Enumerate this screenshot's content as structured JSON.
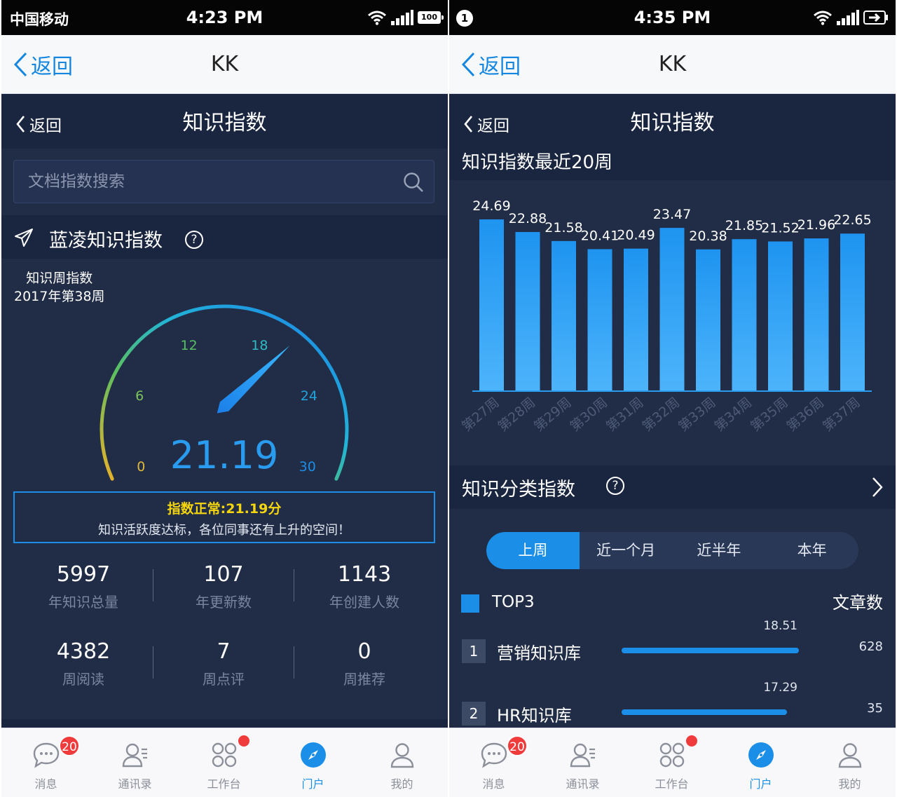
{
  "left": {
    "status": {
      "carrier": "中国移动",
      "time": "4:23 PM",
      "battery": "100"
    },
    "nav": {
      "back": "返回",
      "title": "KK"
    },
    "header": {
      "back": "返回",
      "title": "知识指数"
    },
    "search": {
      "placeholder": "文档指数搜索"
    },
    "section": {
      "title": "蓝凌知识指数",
      "help": "?"
    },
    "gauge": {
      "label_line1": "知识周指数",
      "label_line2": "2017年第38周",
      "value": "21.19",
      "value_num": 21.19,
      "min": 0,
      "max": 30,
      "ticks": [
        "0",
        "6",
        "12",
        "18",
        "24",
        "30"
      ]
    },
    "notice": {
      "line1": "指数正常:21.19分",
      "line2": "知识活跃度达标，各位同事还有上升的空间！"
    },
    "stats": [
      {
        "value": "5997",
        "label": "年知识总量"
      },
      {
        "value": "107",
        "label": "年更新数"
      },
      {
        "value": "1143",
        "label": "年创建人数"
      },
      {
        "value": "4382",
        "label": "周阅读"
      },
      {
        "value": "7",
        "label": "周点评"
      },
      {
        "value": "0",
        "label": "周推荐"
      }
    ]
  },
  "right": {
    "status": {
      "notif": "1",
      "time": "4:35 PM"
    },
    "nav": {
      "back": "返回",
      "title": "KK"
    },
    "header": {
      "back": "返回",
      "title": "知识指数"
    },
    "chart_title": "知识指数最近20周",
    "chart_data": {
      "type": "bar",
      "categories": [
        "第27周",
        "第28周",
        "第29周",
        "第30周",
        "第31周",
        "第32周",
        "第33周",
        "第34周",
        "第35周",
        "第36周",
        "第37周"
      ],
      "values": [
        24.69,
        22.88,
        21.58,
        20.41,
        20.49,
        23.47,
        20.38,
        21.85,
        21.52,
        21.96,
        22.65
      ],
      "value_labels": [
        "24.69",
        "22.88",
        "21.58",
        "20.41",
        "20.49",
        "23.47",
        "20.38",
        "21.85",
        "21.52",
        "21.96",
        "22.65"
      ],
      "title": "知识指数最近20周",
      "xlabel": "",
      "ylabel": "",
      "ylim": [
        0,
        25
      ],
      "grid": false,
      "color": "#2a9cf0"
    },
    "category": {
      "title": "知识分类指数",
      "help": "?"
    },
    "segments": [
      "上周",
      "近一个月",
      "近半年",
      "本年"
    ],
    "top3": {
      "label": "TOP3",
      "right_label": "文章数"
    },
    "ranks": [
      {
        "rank": "1",
        "name": "营销知识库",
        "score": "18.51",
        "score_num": 18.51,
        "count": "628"
      },
      {
        "rank": "2",
        "name": "HR知识库",
        "score": "17.29",
        "score_num": 17.29,
        "count": "35"
      }
    ]
  },
  "tabs": [
    {
      "label": "消息",
      "icon": "message-icon",
      "badge": "20"
    },
    {
      "label": "通讯录",
      "icon": "contacts-icon"
    },
    {
      "label": "工作台",
      "icon": "workbench-icon",
      "dot": true
    },
    {
      "label": "门户",
      "icon": "compass-icon",
      "active": true
    },
    {
      "label": "我的",
      "icon": "profile-icon"
    }
  ],
  "colors": {
    "accent": "#1b8fe8",
    "dark_bg": "#212d46",
    "header_bg": "#1a2640",
    "notice_text": "#f5d60e",
    "badge": "#ef3b3b"
  }
}
